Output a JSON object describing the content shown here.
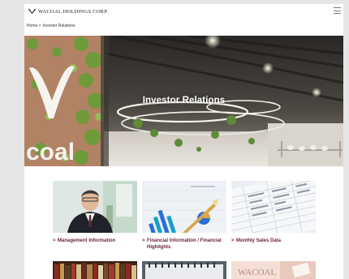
{
  "header": {
    "logo_text": "WACOAL HOLDINGS CORP.",
    "menu_icon": "hamburger-menu-icon"
  },
  "breadcrumb": {
    "home": "Home",
    "separator": ">",
    "current": "Investor Relations"
  },
  "hero": {
    "title": "Investor Relations",
    "sign_text": "coal"
  },
  "cards": [
    {
      "label": "Management Information",
      "chevron": ">"
    },
    {
      "label": "Financial Information / Financial Highlights",
      "chevron": ">"
    },
    {
      "label": "Monthly Sales Data",
      "chevron": ">"
    }
  ],
  "cards_row2": [
    {
      "image": "bookshelf"
    },
    {
      "image": "notebook-spiral"
    },
    {
      "image_text": "WACOAL"
    }
  ],
  "colors": {
    "link": "#6b1f33",
    "page_bg": "#ffffff",
    "outer_bg": "#e6e6e6"
  }
}
